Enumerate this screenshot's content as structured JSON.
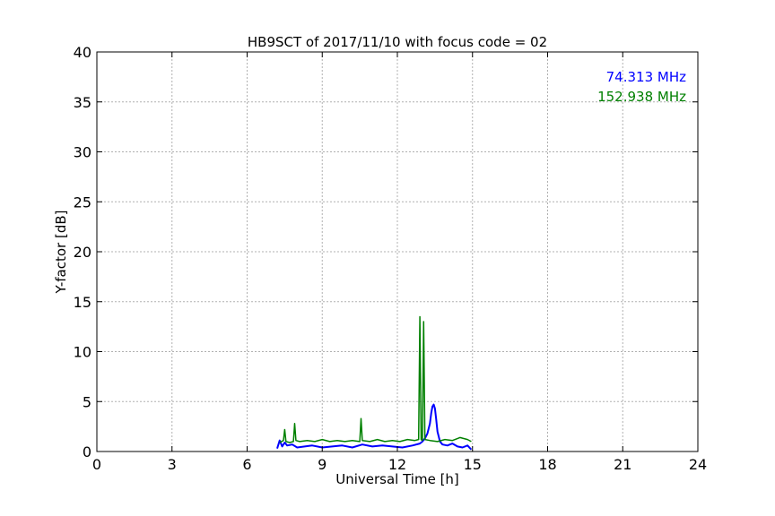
{
  "chart_data": {
    "type": "line",
    "title": "HB9SCT of 2017/11/10 with focus code = 02",
    "xlabel": "Universal Time [h]",
    "ylabel": "Y-factor [dB]",
    "xlim": [
      0,
      24
    ],
    "ylim": [
      0,
      40
    ],
    "xticks": [
      0,
      3,
      6,
      9,
      12,
      15,
      18,
      21,
      24
    ],
    "yticks": [
      0,
      5,
      10,
      15,
      20,
      25,
      30,
      35,
      40
    ],
    "grid": true,
    "legend_position": "top-right",
    "series": [
      {
        "name": "74.313 MHz",
        "color": "#0000ff",
        "x": [
          7.2,
          7.3,
          7.4,
          7.5,
          7.6,
          7.8,
          8.0,
          8.3,
          8.6,
          9.0,
          9.4,
          9.8,
          10.2,
          10.6,
          11.0,
          11.4,
          11.8,
          12.2,
          12.6,
          12.9,
          13.0,
          13.1,
          13.2,
          13.3,
          13.35,
          13.4,
          13.45,
          13.5,
          13.55,
          13.6,
          13.7,
          13.8,
          14.0,
          14.2,
          14.4,
          14.6,
          14.8,
          14.95
        ],
        "y": [
          0.3,
          1.1,
          0.5,
          0.9,
          0.6,
          0.7,
          0.4,
          0.5,
          0.6,
          0.4,
          0.5,
          0.6,
          0.4,
          0.7,
          0.5,
          0.6,
          0.5,
          0.4,
          0.6,
          0.8,
          1.0,
          1.3,
          1.8,
          2.8,
          3.8,
          4.5,
          4.7,
          4.3,
          3.2,
          2.0,
          1.0,
          0.7,
          0.6,
          0.8,
          0.5,
          0.4,
          0.6,
          0.2
        ]
      },
      {
        "name": "152.938 MHz",
        "color": "#008000",
        "x": [
          7.3,
          7.45,
          7.5,
          7.55,
          7.7,
          7.85,
          7.9,
          7.95,
          8.1,
          8.4,
          8.7,
          9.0,
          9.3,
          9.6,
          9.9,
          10.2,
          10.5,
          10.55,
          10.6,
          10.9,
          11.2,
          11.5,
          11.8,
          12.1,
          12.4,
          12.7,
          12.85,
          12.9,
          12.95,
          13.0,
          13.05,
          13.1,
          13.3,
          13.6,
          13.9,
          14.2,
          14.5,
          14.8,
          14.95
        ],
        "y": [
          0.9,
          1.1,
          2.2,
          1.0,
          0.9,
          1.0,
          2.8,
          1.1,
          1.0,
          1.1,
          1.0,
          1.2,
          1.0,
          1.1,
          1.0,
          1.1,
          1.0,
          3.3,
          1.1,
          1.0,
          1.2,
          1.0,
          1.1,
          1.0,
          1.2,
          1.1,
          1.2,
          13.5,
          1.2,
          1.1,
          13.0,
          1.2,
          1.1,
          1.0,
          1.2,
          1.1,
          1.4,
          1.2,
          1.0
        ]
      }
    ]
  }
}
